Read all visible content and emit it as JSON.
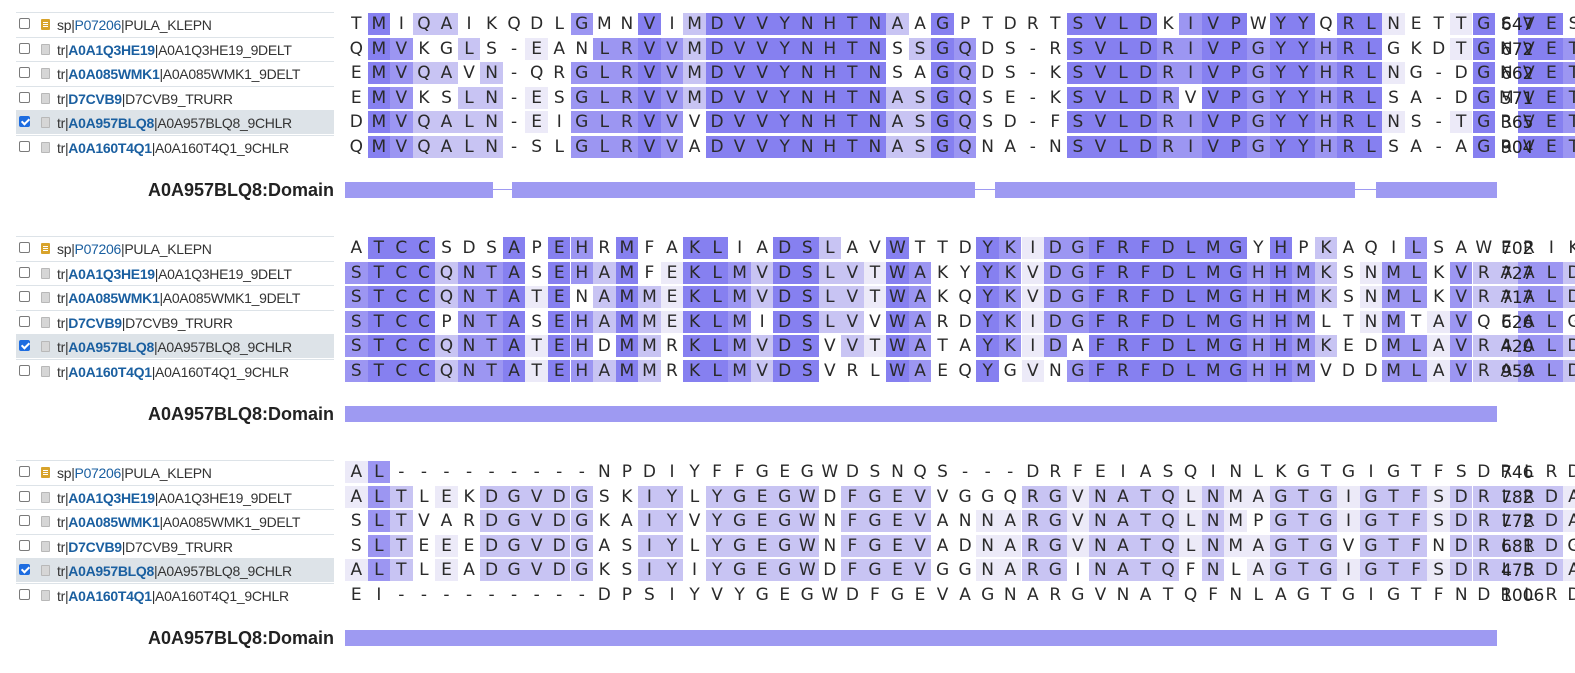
{
  "blocks": [
    {
      "rows": [
        {
          "db": "sp",
          "accession": "P07206",
          "entry": "PULA_KLEPN",
          "selected": false,
          "seq": "TMIQAIKQDLGMNVIMDVVYNHTNAAGPTDRTSVLDKIVPWYYQRLNETTGSVES",
          "end": "647"
        },
        {
          "db": "tr",
          "accession": "A0A1Q3HE19",
          "entry": "A0A1Q3HE19_9DELT",
          "selected": false,
          "seq": "QMVKGLS-EANLRVVMDVVYNHTNSSGQDS-RSVLDRIVPGYYHRLGKDTGNVET",
          "end": "672"
        },
        {
          "db": "tr",
          "accession": "A0A085WMK1",
          "entry": "A0A085WMK1_9DELT",
          "selected": false,
          "seq": "EMVQAVN-QRGLRVVMDVVYNHTNSAGQDS-KSVLDRIVPGYYHRLNG-DGNVET",
          "end": "662"
        },
        {
          "db": "tr",
          "accession": "D7CVB9",
          "entry": "D7CVB9_TRURR",
          "selected": false,
          "seq": "EMVKSLN-ESGLRVVMDVVYNHTNASGQSE-KSVLDRVVPGYYHRLSA-DGMVET",
          "end": "571"
        },
        {
          "db": "tr",
          "accession": "A0A957BLQ8",
          "entry": "A0A957BLQ8_9CHLR",
          "selected": true,
          "seq": "DMVQALN-EIGLRVVVDVVYNHTNASGQSD-FSVLDRIVPGYYHRLNS-TGRVET",
          "end": "365"
        },
        {
          "db": "tr",
          "accession": "A0A160T4Q1",
          "entry": "A0A160T4Q1_9CHLR",
          "selected": false,
          "seq": "QMVQALN-SLGLRVVADVVYNHTNASGQNA-NSVLDRIVPGYYHRLSA-AGRVET",
          "end": "904"
        }
      ],
      "domain": {
        "label": "A0A957BLQ8:Domain",
        "segments": [
          [
            0,
            0.1285
          ],
          [
            0.145,
            0.547
          ],
          [
            0.564,
            0.877
          ],
          [
            0.895,
            1.0
          ]
        ]
      }
    },
    {
      "rows": [
        {
          "db": "sp",
          "accession": "P07206",
          "entry": "PULA_KLEPN",
          "selected": false,
          "seq": "ATCCSDSAPEHRMFAKLIADSLAVWTTDYKIDGFRFDLMGYHPKAQILSAWERIK",
          "end": "702"
        },
        {
          "db": "tr",
          "accession": "A0A1Q3HE19",
          "entry": "A0A1Q3HE19_9DELT",
          "selected": false,
          "seq": "STCCQNTASEHAMFEKLMVDSLVTWAKYYKVDGFRFDLMGHHMKSNMLKVRAALD",
          "end": "727"
        },
        {
          "db": "tr",
          "accession": "A0A085WMK1",
          "entry": "A0A085WMK1_9DELT",
          "selected": false,
          "seq": "STCCQNTATENAMMEKLMVDSLVTWAKQYKVDGFRFDLMGHHMKSNMLKVRAALD",
          "end": "717"
        },
        {
          "db": "tr",
          "accession": "D7CVB9",
          "entry": "D7CVB9_TRURR",
          "selected": false,
          "seq": "STCCPNTASEHAMMEKLMIDSLVVWARDYKIDGFRFDLMGHHMLTNMTAVQEALG",
          "end": "626"
        },
        {
          "db": "tr",
          "accession": "A0A957BLQ8",
          "entry": "A0A957BLQ8_9CHLR",
          "selected": true,
          "seq": "STCCQNTATEHDMMRKLMVDSVVTWATAYKIDAFRFDLMGHHMKEDMLAVRAALD",
          "end": "420"
        },
        {
          "db": "tr",
          "accession": "A0A160T4Q1",
          "entry": "A0A160T4Q1_9CHLR",
          "selected": false,
          "seq": "STCCQNTATEHAMMRKLMVDSVRLWAEQYGVNGFRFDLMGHHMVDDMLAVRAALD",
          "end": "959"
        }
      ],
      "domain": {
        "label": "A0A957BLQ8:Domain",
        "segments": [
          [
            0,
            1.0
          ]
        ]
      }
    },
    {
      "rows": [
        {
          "db": "sp",
          "accession": "P07206",
          "entry": "PULA_KLEPN",
          "selected": false,
          "seq": "AL---------NPDIYFFGEGWDSNQS---DRFEIASQINLKGTGIGTFSDRLRDS",
          "end": "746"
        },
        {
          "db": "tr",
          "accession": "A0A1Q3HE19",
          "entry": "A0A1Q3HE19_9DELT",
          "selected": false,
          "seq": "ALTLEKDGVDGSKIYLYGEGWDFGEVVGGQRGVNATQLNMAGTGIGTFSDRLRDA",
          "end": "782"
        },
        {
          "db": "tr",
          "accession": "A0A085WMK1",
          "entry": "A0A085WMK1_9DELT",
          "selected": false,
          "seq": "SLTVARDGVDGKAIYVYGEGWNFGEVANNARGVNATQLNMPGTGIGTFSDRLRDA",
          "end": "772"
        },
        {
          "db": "tr",
          "accession": "D7CVB9",
          "entry": "D7CVB9_TRURR",
          "selected": false,
          "seq": "SLTEEEDGVDGASIYLYGEGWNFGEVADNARGVNATQLNMAGTGVGTFNDRLRDG",
          "end": "681"
        },
        {
          "db": "tr",
          "accession": "A0A957BLQ8",
          "entry": "A0A957BLQ8_9CHLR",
          "selected": true,
          "seq": "ALTLEADGVDGKSIYIYGEGWDFGEVGGNARGINATQFNLAGTGIGTFSDRLRDA",
          "end": "475"
        },
        {
          "db": "tr",
          "accession": "A0A160T4Q1",
          "entry": "A0A160T4Q1_9CHLR",
          "selected": false,
          "seq": "EI---------DPSIYVYGEGWDFGEVAGNARGVNATQFNLAGTGIGTFNDRLRDA",
          "end": "1006"
        }
      ],
      "domain": {
        "label": "A0A957BLQ8:Domain",
        "segments": [
          [
            0,
            1.0
          ]
        ]
      }
    }
  ],
  "colors": {
    "conservation_levels": [
      "#ffffff",
      "#eceaf8",
      "#c8c4f3",
      "#9c96f2",
      "#8680f0"
    ],
    "domain_bar": "#9e9af2",
    "selected_row": "#dde3e8",
    "accession_link": "#1a5fa0",
    "reviewed_icon": "#d8a32b",
    "unreviewed_icon": "#d6d6d6"
  },
  "icons": {
    "reviewed": "reviewed-doc-icon",
    "unreviewed": "unreviewed-doc-icon",
    "checkbox": "checkbox-icon"
  }
}
